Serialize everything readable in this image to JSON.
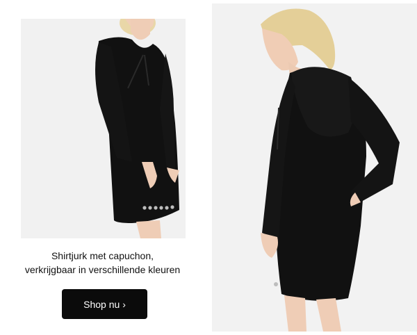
{
  "caption": {
    "line1": "Shirtjurk met capuchon,",
    "line2": "verkrijgbaar in verschillende kleuren"
  },
  "cta": {
    "label": "Shop nu ›"
  },
  "colors": {
    "button_bg": "#0b0b0b",
    "button_text": "#ffffff",
    "photo_bg": "#f1f1f1",
    "dress": "#111111"
  }
}
